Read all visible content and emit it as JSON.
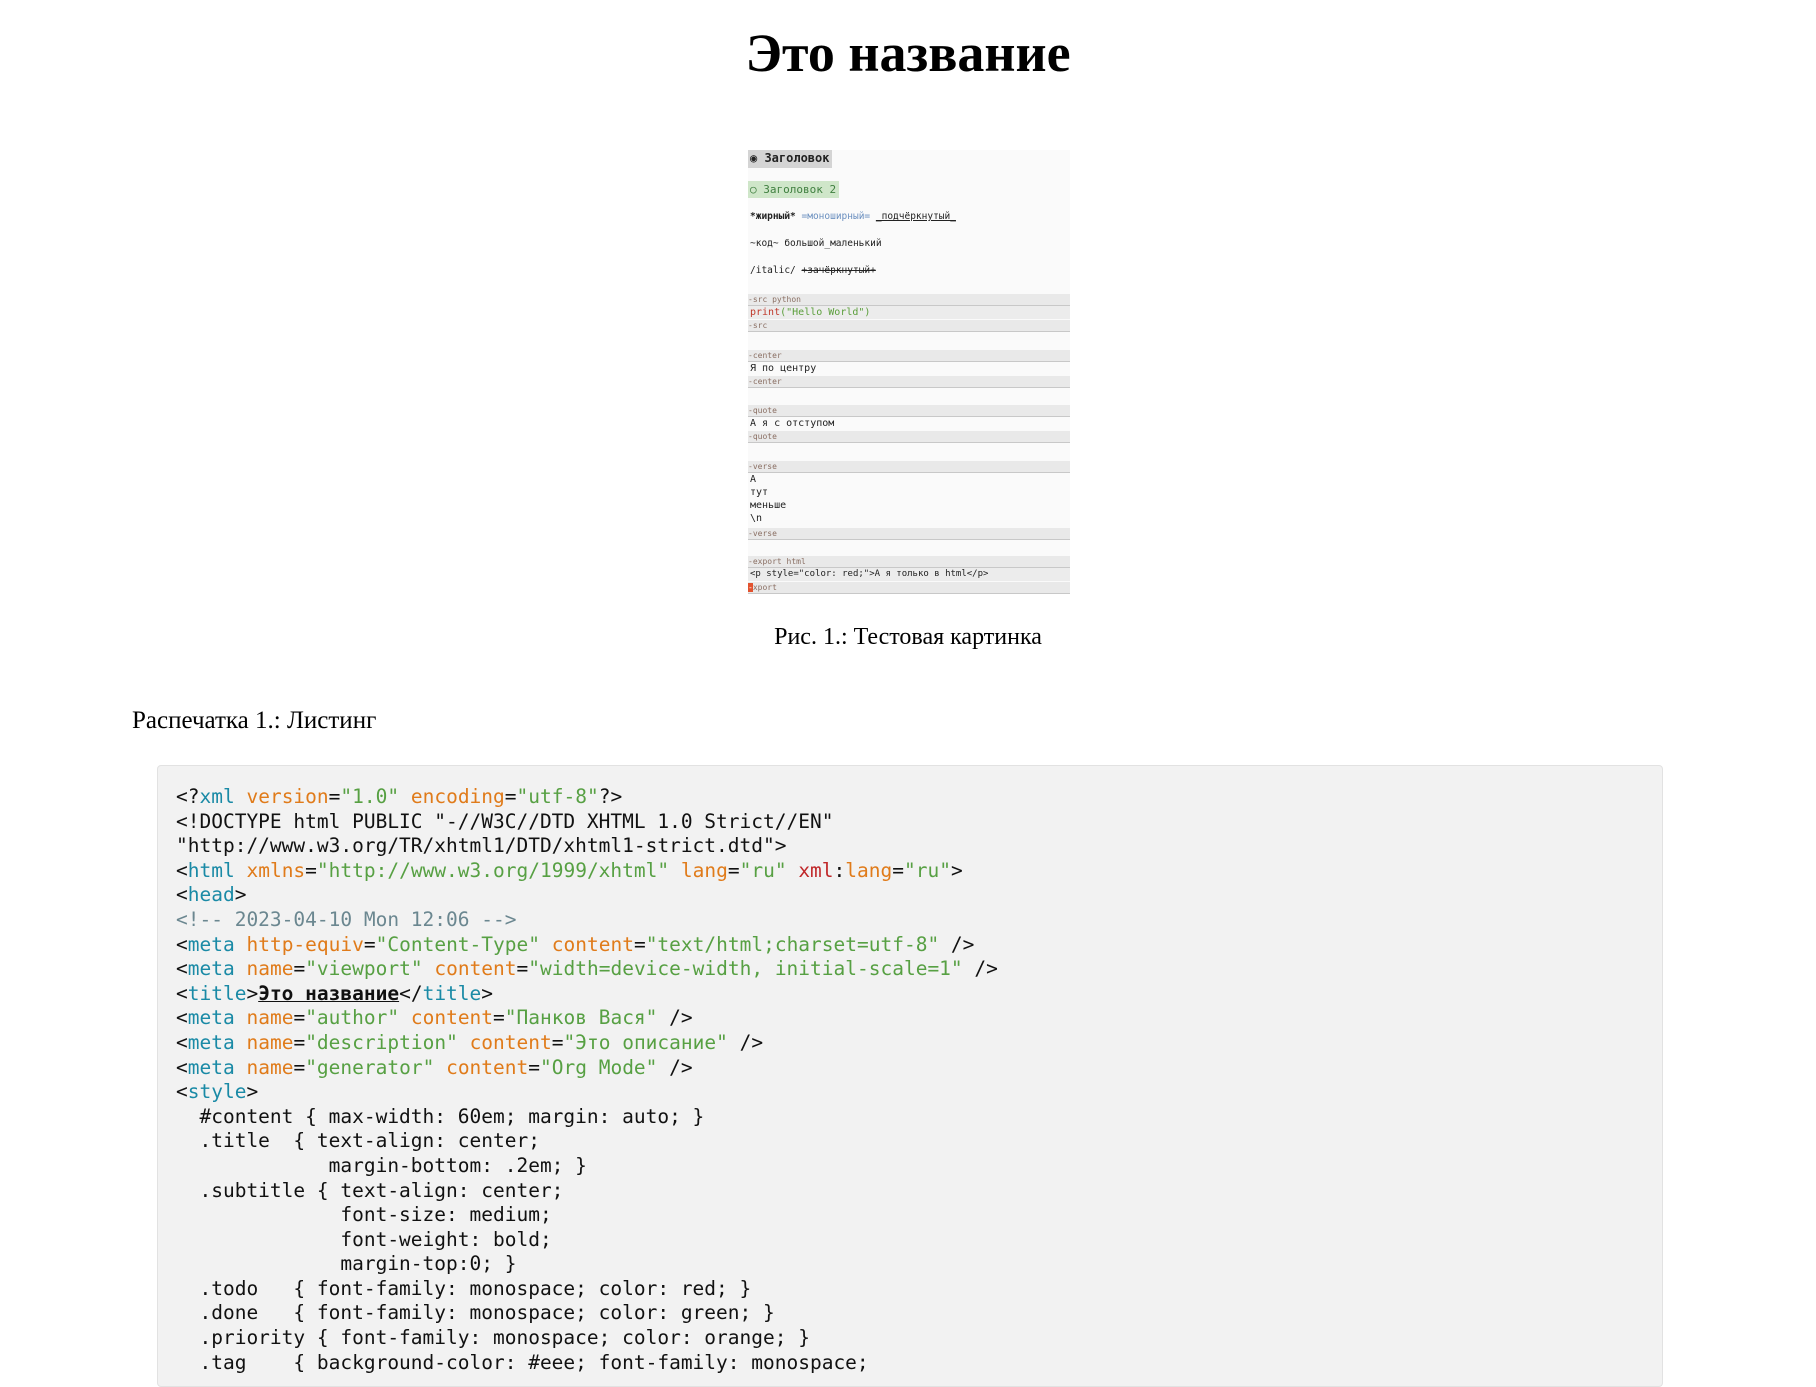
{
  "document": {
    "title": "Это название"
  },
  "figure": {
    "screenshot": {
      "heading1": "◉ Заголовок",
      "heading2": "○ Заголовок 2",
      "line_markup_1_bold": "*жирный*",
      "line_markup_1_mono": "=моноширный=",
      "line_markup_1_under": "_подчёркнутый_",
      "line_markup_2": "~код~ большой_маленький",
      "line_markup_3_italic": "/italic/",
      "line_markup_3_strike": "+зачёркнутый+",
      "src_begin": "-src python",
      "src_body_kw": "print",
      "src_body_str": "(\"Hello World\")",
      "src_end": "-src",
      "center_begin": "-center",
      "center_body": "Я по центру",
      "center_end": "-center",
      "quote_begin": "-quote",
      "quote_body": "А я с отступом",
      "quote_end": "-quote",
      "verse_begin": "-verse",
      "verse_lines": [
        "А",
        "тут",
        "меньше",
        "\\n"
      ],
      "verse_end": "-verse",
      "export_begin": "-export html",
      "export_body": "<p style=\"color: red;\">А я только в html</p>",
      "export_end": "xport",
      "export_cursor": "-"
    },
    "caption": "Рис. 1.: Тестовая картинка"
  },
  "listing": {
    "caption": "Распечатка 1.: Листинг",
    "lines": [
      "<?xml version=\"1.0\" encoding=\"utf-8\"?>",
      "<!DOCTYPE html PUBLIC \"-//W3C//DTD XHTML 1.0 Strict//EN\"",
      "\"http://www.w3.org/TR/xhtml1/DTD/xhtml1-strict.dtd\">",
      "<html xmlns=\"http://www.w3.org/1999/xhtml\" lang=\"ru\" xml:lang=\"ru\">",
      "<head>",
      "<!-- 2023-04-10 Mon 12:06 -->",
      "<meta http-equiv=\"Content-Type\" content=\"text/html;charset=utf-8\" />",
      "<meta name=\"viewport\" content=\"width=device-width, initial-scale=1\" />",
      "<title>Это название</title>",
      "<meta name=\"author\" content=\"Панков Вася\" />",
      "<meta name=\"description\" content=\"Это описание\" />",
      "<meta name=\"generator\" content=\"Org Mode\" />",
      "<style>",
      "  #content { max-width: 60em; margin: auto; }",
      "  .title  { text-align: center;",
      "             margin-bottom: .2em; }",
      "  .subtitle { text-align: center;",
      "              font-size: medium;",
      "              font-weight: bold;",
      "              margin-top:0; }",
      "  .todo   { font-family: monospace; color: red; }",
      "  .done   { font-family: monospace; color: green; }",
      "  .priority { font-family: monospace; color: orange; }",
      "  .tag    { background-color: #eee; font-family: monospace;"
    ]
  }
}
